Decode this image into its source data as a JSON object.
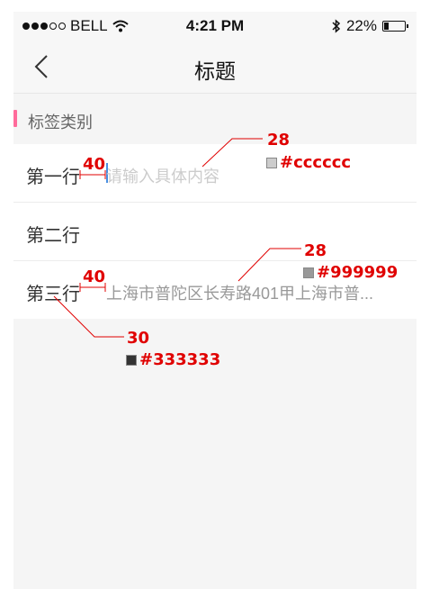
{
  "status_bar": {
    "carrier": "BELL",
    "time": "4:21 PM",
    "battery": "22%",
    "battery_level": 0.22
  },
  "nav": {
    "title": "标题"
  },
  "section": {
    "label": "标签类别",
    "accent_color": "#ff6b9b"
  },
  "rows": [
    {
      "label": "第一行",
      "placeholder": "请输入具体内容"
    },
    {
      "label": "第二行",
      "value": ""
    },
    {
      "label": "第三行",
      "value": "上海市普陀区长寿路401甲上海市普..."
    }
  ],
  "annotations": {
    "gap1": "40",
    "size1": "28",
    "color1": "#cccccc",
    "size2": "28",
    "color2": "#999999",
    "gap2": "40",
    "size3": "30",
    "color3": "#333333"
  },
  "colors": {
    "annotation": "#e00000",
    "caret": "#4a90e2"
  }
}
